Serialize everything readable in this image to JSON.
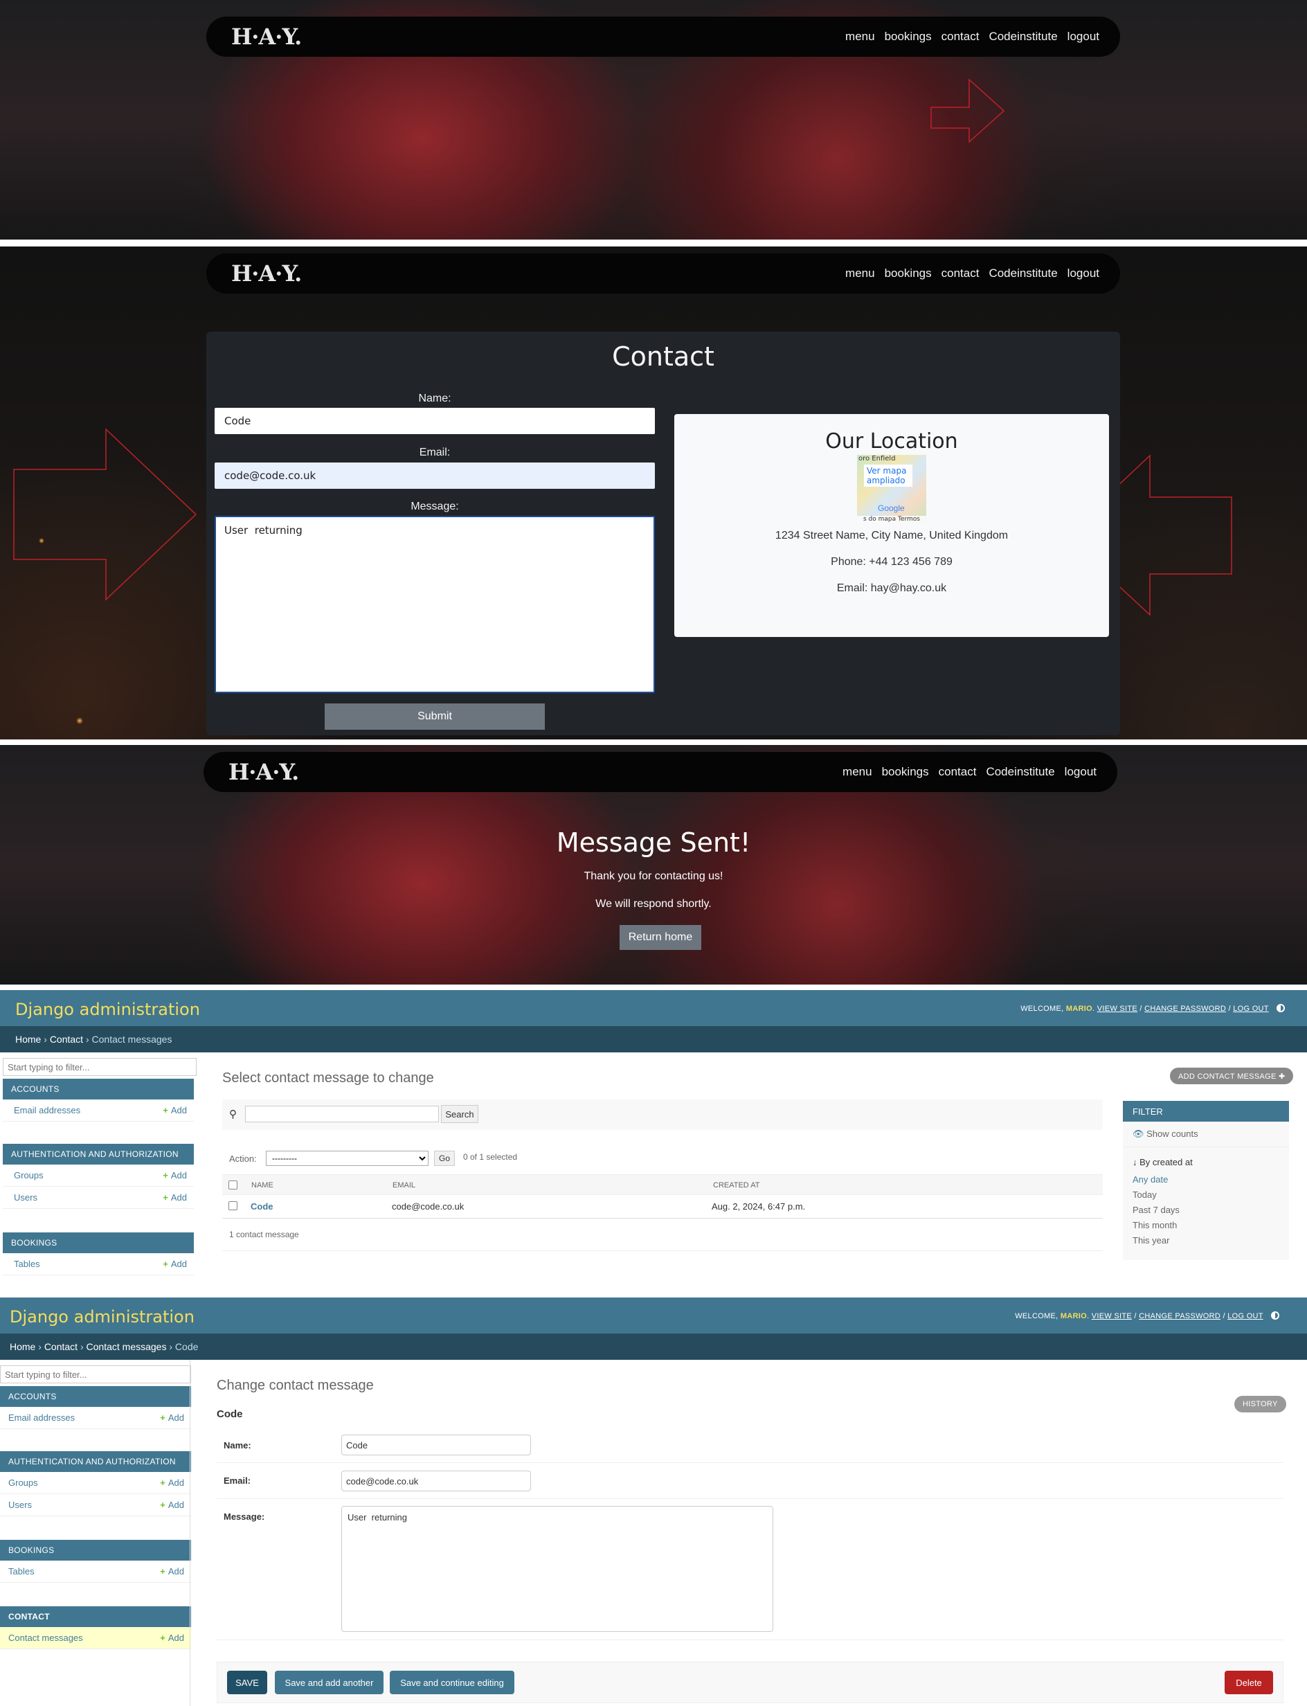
{
  "site": {
    "logo": "H·A·Y.",
    "nav": [
      "menu",
      "bookings",
      "contact",
      "Codeinstitute",
      "logout"
    ]
  },
  "contact": {
    "title": "Contact",
    "name_label": "Name:",
    "name_value": "Code",
    "email_label": "Email:",
    "email_value": "code@code.co.uk",
    "message_label": "Message:",
    "message_value": "User  returning",
    "submit": "Submit",
    "location": {
      "title": "Our Location",
      "map_top": "oro      Enfield",
      "map_link": "Ver mapa ampliado",
      "map_brand": "Google",
      "map_foot": "s do mapa   Termos",
      "address": "1234 Street Name, City Name, United Kingdom",
      "phone": "Phone: +44 123 456 789",
      "email": "Email: hay@hay.co.uk"
    }
  },
  "sent": {
    "title": "Message Sent!",
    "line1": "Thank you for contacting us!",
    "line2": "We will respond shortly.",
    "button": "Return home"
  },
  "admin": {
    "brand": "Django administration",
    "welcome": "Welcome,",
    "user": "MARIO",
    "view_site": "View site",
    "change_password": "Change password",
    "log_out": "Log out",
    "filter_placeholder": "Start typing to filter...",
    "add_label": "Add",
    "modules": {
      "accounts": "Accounts",
      "email_addresses": "Email addresses",
      "auth": "Authentication and Authorization",
      "groups": "Groups",
      "users": "Users",
      "bookings": "Bookings",
      "tables": "Tables",
      "contact": "Contact",
      "contact_messages": "Contact messages"
    },
    "changelist": {
      "crumb_home": "Home",
      "crumb_app": "Contact",
      "crumb_model": "Contact messages",
      "title": "Select contact message to change",
      "add_button": "Add contact message",
      "search_button": "Search",
      "action_label": "Action:",
      "action_value": "---------",
      "go": "Go",
      "selected": "0 of 1 selected",
      "columns": [
        "Name",
        "Email",
        "Created at"
      ],
      "row": {
        "name": "Code",
        "email": "code@code.co.uk",
        "created": "Aug. 2, 2024, 6:47 p.m."
      },
      "count": "1 contact message",
      "filter": {
        "title": "Filter",
        "show_counts": "Show counts",
        "by": "↓ By created at",
        "options": [
          "Any date",
          "Today",
          "Past 7 days",
          "This month",
          "This year"
        ]
      }
    },
    "change": {
      "crumb_home": "Home",
      "crumb_app": "Contact",
      "crumb_model": "Contact messages",
      "crumb_obj": "Code",
      "title": "Change contact message",
      "object": "Code",
      "history": "History",
      "name_label": "Name:",
      "name_value": "Code",
      "email_label": "Email:",
      "email_value": "code@code.co.uk",
      "message_label": "Message:",
      "message_value": "User  returning",
      "save": "SAVE",
      "save_add": "Save and add another",
      "save_continue": "Save and continue editing",
      "delete": "Delete"
    }
  },
  "colors": {
    "admin_primary": "#417690",
    "admin_secondary": "#264b5d",
    "admin_accent": "#f5dd5d",
    "site_button": "#6c757d",
    "delete": "#ba2121",
    "save": "#205067",
    "arrow": "#c0202a"
  }
}
